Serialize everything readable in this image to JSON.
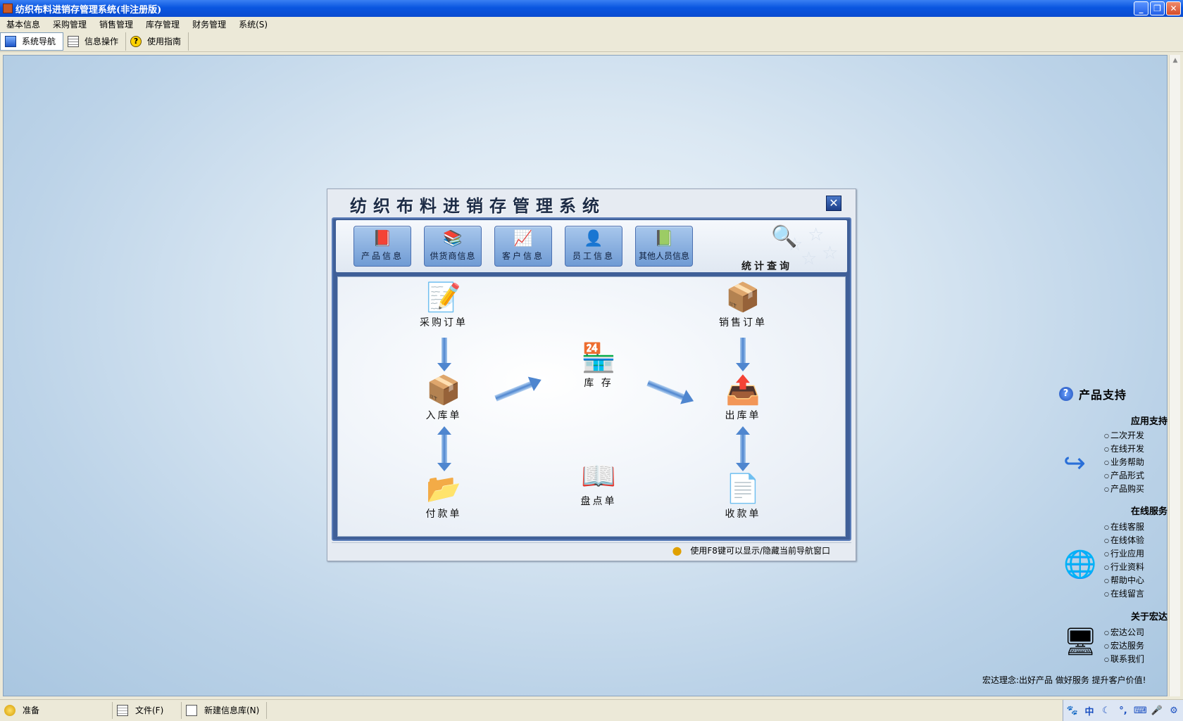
{
  "window": {
    "title": "纺织布料进销存管理系统(非注册版)"
  },
  "menubar": {
    "items": [
      "基本信息",
      "采购管理",
      "销售管理",
      "库存管理",
      "财务管理",
      "系统(S)"
    ]
  },
  "toolbar": {
    "items": [
      "系统导航",
      "信息操作",
      "使用指南"
    ]
  },
  "dialog": {
    "title": "纺织布料进销存管理系统",
    "tabs": [
      "产品信息",
      "供货商信息",
      "客户信息",
      "员工信息",
      "其他人员信息"
    ],
    "stats_label": "统计查询",
    "nodes": {
      "purchase_order": "采购订单",
      "stock_in": "入库单",
      "payment": "付款单",
      "inventory": "库 存",
      "stocktake": "盘点单",
      "sales_order": "销售订单",
      "stock_out": "出库单",
      "receipt": "收款单"
    },
    "hint": "使用F8键可以显示/隐藏当前导航窗口"
  },
  "support": {
    "title": "产品支持",
    "app_support": {
      "heading": "应用支持",
      "items": [
        "二次开发",
        "在线开发",
        "业务帮助",
        "产品形式",
        "产品购买"
      ]
    },
    "online_service": {
      "heading": "在线服务",
      "items": [
        "在线客服",
        "在线体验",
        "行业应用",
        "行业资料",
        "帮助中心",
        "在线留言"
      ]
    },
    "about": {
      "heading": "关于宏达",
      "items": [
        "宏达公司",
        "宏达服务",
        "联系我们"
      ]
    },
    "slogan": "宏达理念:出好产品  做好服务  提升客户价值!"
  },
  "statusbar": {
    "items": [
      "准备",
      "文件(F)",
      "新建信息库(N)"
    ],
    "ime": "中"
  }
}
